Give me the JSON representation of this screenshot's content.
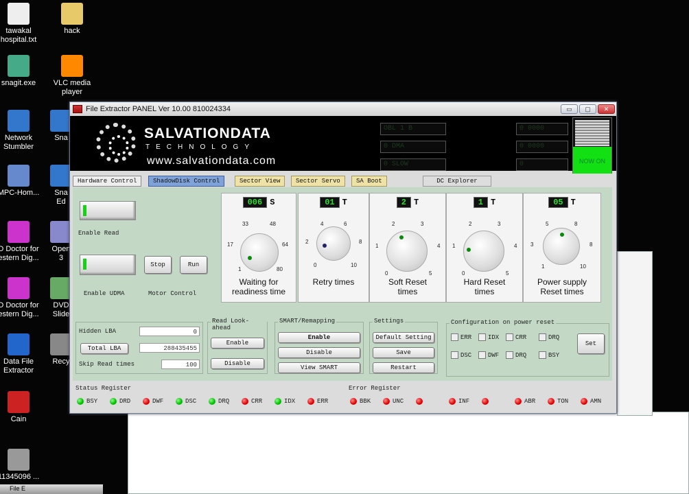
{
  "desktop": {
    "icons": [
      {
        "label": "tawakal\nhospital.txt",
        "icon": "text-file-icon"
      },
      {
        "label": "hack",
        "icon": "folder-icon"
      },
      {
        "label": "snagit.exe",
        "icon": "snagit-icon"
      },
      {
        "label": "VLC media\nplayer",
        "icon": "vlc-icon"
      },
      {
        "label": "Network\nStumbler",
        "icon": "network-icon"
      },
      {
        "label": "Sna",
        "icon": "app-icon"
      },
      {
        "label": "MPC-Hom...",
        "icon": "mpc-icon"
      },
      {
        "label": "Sna\nEd",
        "icon": "app-icon"
      },
      {
        "label": "D Doctor for\nestern Dig...",
        "icon": "doctor-icon"
      },
      {
        "label": "Open\n3",
        "icon": "app-icon"
      },
      {
        "label": "D Doctor for\nestern Dig...",
        "icon": "doctor-icon"
      },
      {
        "label": "DVD\nSlide",
        "icon": "app-icon"
      },
      {
        "label": "Data File\nExtractor",
        "icon": "extractor-icon"
      },
      {
        "label": "Recy",
        "icon": "recycle-icon"
      },
      {
        "label": "Cain",
        "icon": "cain-icon"
      },
      {
        "label": "11345096 ...",
        "icon": "image-icon"
      }
    ],
    "taskbar_item": "File E"
  },
  "window": {
    "title": "File Extractor PANEL   Ver 10.00  810024334",
    "minimize": "▭",
    "maximize": "▢",
    "close": "✕"
  },
  "banner": {
    "brand": "SALVATIONDATA",
    "sub": "TECHNOLOGY",
    "url": "www.salvationdata.com",
    "lcd_left": [
      "OBL  1 B",
      "0 DMA",
      "0 SLOW"
    ],
    "lcd_right": [
      "0 0000",
      "0 0000",
      "0"
    ],
    "status": "NOW ON"
  },
  "tabs": [
    {
      "label": "Hardware Control",
      "style": "sel"
    },
    {
      "label": "ShadowDisk Control",
      "style": "blue"
    },
    {
      "label": "Sector View",
      "style": "yel"
    },
    {
      "label": "Sector Servo",
      "style": "yel"
    },
    {
      "label": "SA Boot",
      "style": "yel"
    },
    {
      "label": "DC Explorer",
      "style": "gray"
    }
  ],
  "hardware": {
    "enable_read": "Enable Read",
    "enable_udma": "Enable UDMA",
    "stop": "Stop",
    "run": "Run",
    "motor_control": "Motor Control"
  },
  "dials": [
    {
      "value": "006",
      "unit": "S",
      "ticks": [
        "33",
        "48",
        "17",
        "64",
        "1",
        "80"
      ],
      "title": "Waiting for\nreadiness time"
    },
    {
      "value": "01",
      "unit": "T",
      "ticks": [
        "4",
        "6",
        "2",
        "8",
        "0",
        "10"
      ],
      "title": "Retry times"
    },
    {
      "value": "2",
      "unit": "T",
      "ticks": [
        "2",
        "3",
        "1",
        "4",
        "0",
        "5"
      ],
      "title": "Soft Reset\ntimes"
    },
    {
      "value": "1",
      "unit": "T",
      "ticks": [
        "2",
        "3",
        "1",
        "4",
        "0",
        "5"
      ],
      "title": "Hard Reset\ntimes"
    },
    {
      "value": "05",
      "unit": "T",
      "ticks": [
        "5",
        "8",
        "3",
        "8",
        "1",
        "10"
      ],
      "title": "Power supply\nReset times"
    }
  ],
  "lba": {
    "hidden_lba": "Hidden LBA",
    "hidden_value": "0",
    "total_lba": "Total LBA",
    "total_value": "288435455",
    "skip_read": "Skip Read times",
    "skip_value": "100"
  },
  "read_lookahead": {
    "title": "Read Look-ahead",
    "enable": "Enable",
    "disable": "Disable"
  },
  "smart": {
    "title": "SMART/Remapping",
    "enable": "Enable",
    "disable": "Disable",
    "view": "View SMART"
  },
  "settings": {
    "title": "Settings",
    "default": "Default Setting",
    "save": "Save",
    "restart": "Restart"
  },
  "config": {
    "title": "Configuration on power reset",
    "checks": [
      "ERR",
      "IDX",
      "CRR",
      "DRQ",
      "DSC",
      "DWF",
      "DRQ",
      "BSY"
    ],
    "set": "Set"
  },
  "status_register": {
    "title": "Status Register",
    "leds": [
      {
        "label": "BSY",
        "color": "g"
      },
      {
        "label": "DRD",
        "color": "g"
      },
      {
        "label": "DWF",
        "color": "r"
      },
      {
        "label": "DSC",
        "color": "g"
      },
      {
        "label": "DRQ",
        "color": "g"
      },
      {
        "label": "CRR",
        "color": "r"
      },
      {
        "label": "IDX",
        "color": "g"
      },
      {
        "label": "ERR",
        "color": "r"
      }
    ]
  },
  "error_register": {
    "title": "Error Register",
    "leds": [
      {
        "label": "BBK",
        "color": "r"
      },
      {
        "label": "UNC",
        "color": "r"
      },
      {
        "label": "",
        "color": "r"
      },
      {
        "label": "INF",
        "color": "r"
      },
      {
        "label": "",
        "color": "r"
      },
      {
        "label": "ABR",
        "color": "r"
      },
      {
        "label": "TON",
        "color": "r"
      },
      {
        "label": "AMN",
        "color": "r"
      }
    ]
  }
}
